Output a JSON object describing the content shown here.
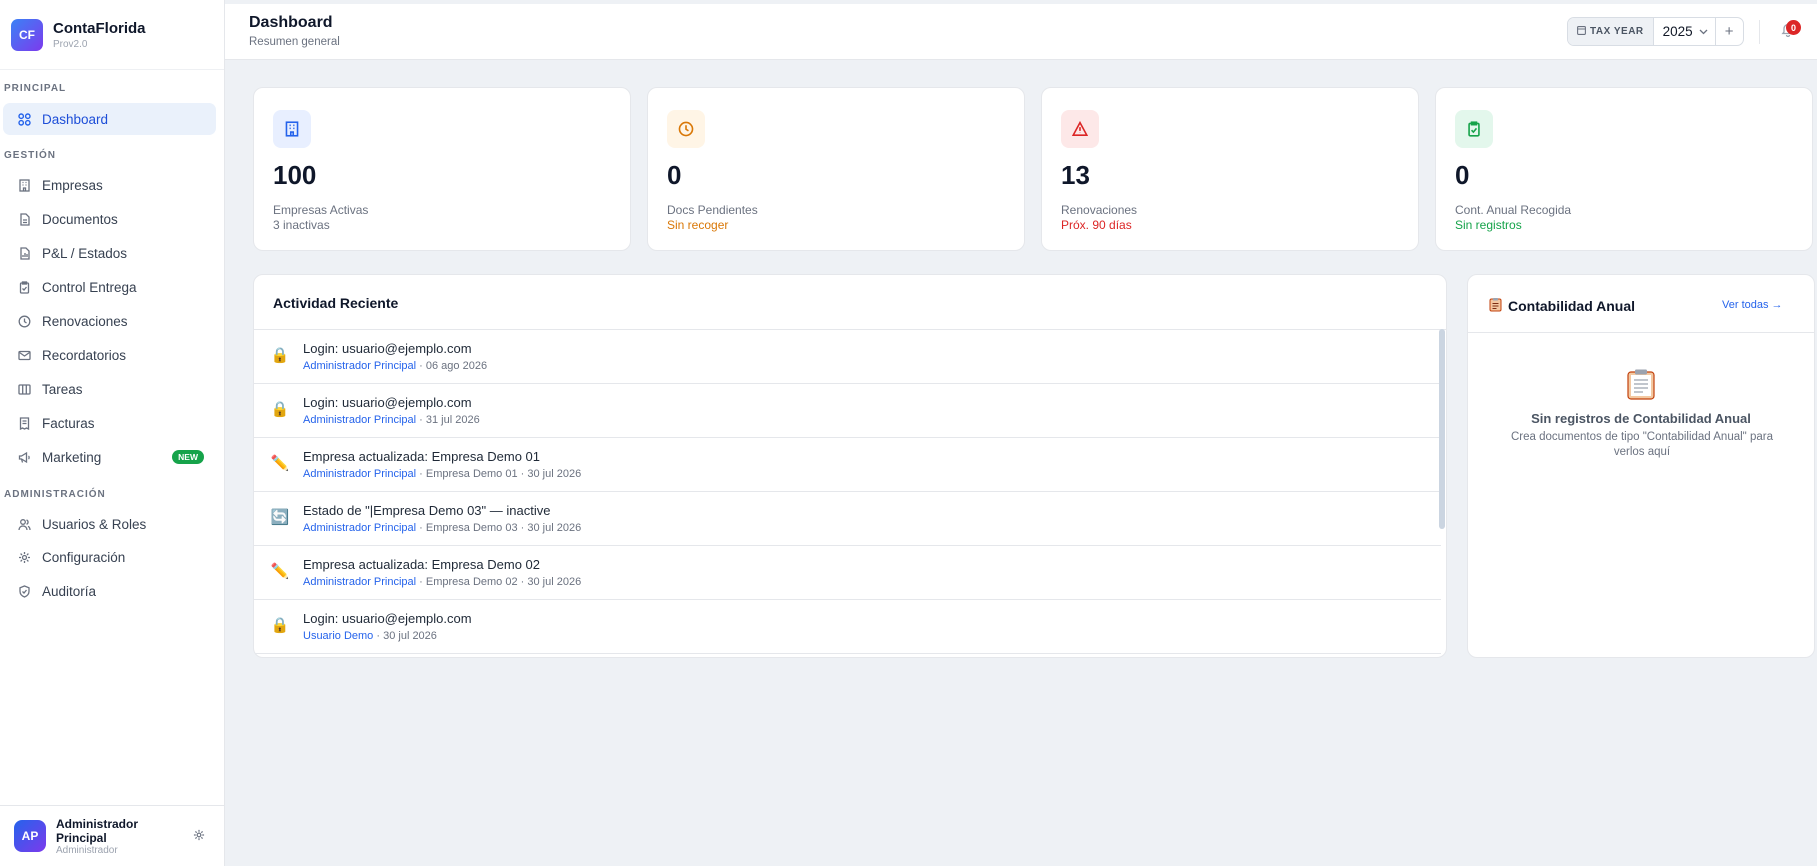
{
  "brand": {
    "initials": "CF",
    "name": "ContaFlorida",
    "version": "Prov2.0"
  },
  "nav": {
    "sections": [
      "PRINCIPAL",
      "GESTIÓN",
      "ADMINISTRACIÓN"
    ],
    "items": [
      {
        "label": "Dashboard",
        "icon": "grid-icon",
        "active": true
      },
      {
        "label": "Empresas",
        "icon": "building-icon"
      },
      {
        "label": "Documentos",
        "icon": "document-icon"
      },
      {
        "label": "P&L / Estados",
        "icon": "report-icon"
      },
      {
        "label": "Control Entrega",
        "icon": "clipboard-check-icon"
      },
      {
        "label": "Renovaciones",
        "icon": "clock-icon"
      },
      {
        "label": "Recordatorios",
        "icon": "mail-icon"
      },
      {
        "label": "Tareas",
        "icon": "kanban-icon"
      },
      {
        "label": "Facturas",
        "icon": "receipt-icon"
      },
      {
        "label": "Marketing",
        "icon": "megaphone-icon",
        "badge": "NEW"
      },
      {
        "label": "Usuarios & Roles",
        "icon": "users-icon"
      },
      {
        "label": "Configuración",
        "icon": "gear-icon"
      },
      {
        "label": "Auditoría",
        "icon": "shield-icon"
      }
    ]
  },
  "user": {
    "initials": "AP",
    "name": "Administrador Principal",
    "role": "Administrador"
  },
  "header": {
    "title": "Dashboard",
    "subtitle": "Resumen general",
    "tax_year_label": "TAX YEAR",
    "tax_year": "2025",
    "notifications": "0"
  },
  "stats": [
    {
      "value": "100",
      "label": "Empresas Activas",
      "sub": "3 inactivas",
      "sub_color": "#6b7280",
      "icon": "building-icon",
      "icon_bg": "#e8efff",
      "icon_color": "#2563eb"
    },
    {
      "value": "0",
      "label": "Docs Pendientes",
      "sub": "Sin recoger",
      "sub_color": "#d97706",
      "icon": "clock-icon",
      "icon_bg": "#fff5e6",
      "icon_color": "#d97706"
    },
    {
      "value": "13",
      "label": "Renovaciones",
      "sub": "Próx. 90 días",
      "sub_color": "#dc2626",
      "icon": "warning-icon",
      "icon_bg": "#fde8e8",
      "icon_color": "#dc2626"
    },
    {
      "value": "0",
      "label": "Cont. Anual Recogida",
      "sub": "Sin registros",
      "sub_color": "#16a34a",
      "icon": "clipboard-check-icon",
      "icon_bg": "#e3f7ec",
      "icon_color": "#16a34a"
    }
  ],
  "activity": {
    "title": "Actividad Reciente",
    "items": [
      {
        "icon": "lock-icon",
        "glyph": "🔒",
        "text": "Login: usuario@ejemplo.com",
        "user": "Administrador Principal",
        "meta": " · 06 ago 2026"
      },
      {
        "icon": "lock-icon",
        "glyph": "🔒",
        "text": "Login: usuario@ejemplo.com",
        "user": "Administrador Principal",
        "meta": " · 31 jul 2026"
      },
      {
        "icon": "pencil-icon",
        "glyph": "✏️",
        "text": "Empresa actualizada: Empresa Demo 01",
        "user": "Administrador Principal",
        "meta": " · Empresa Demo 01 · 30 jul 2026"
      },
      {
        "icon": "refresh-icon",
        "glyph": "🔄",
        "text": "Estado de \"|Empresa Demo 03\" — inactive",
        "user": "Administrador Principal",
        "meta": " · Empresa Demo 03 · 30 jul 2026"
      },
      {
        "icon": "pencil-icon",
        "glyph": "✏️",
        "text": "Empresa actualizada: Empresa Demo 02",
        "user": "Administrador Principal",
        "meta": " · Empresa Demo 02 · 30 jul 2026"
      },
      {
        "icon": "lock-icon",
        "glyph": "🔒",
        "text": "Login: usuario@ejemplo.com",
        "user": "Usuario Demo",
        "meta": " · 30 jul 2026"
      }
    ]
  },
  "contabilidad": {
    "title": "Contabilidad Anual",
    "link": "Ver todas →",
    "empty_title": "Sin registros de Contabilidad Anual",
    "empty_desc": "Crea documentos de tipo \"Contabilidad Anual\" para verlos aquí"
  }
}
